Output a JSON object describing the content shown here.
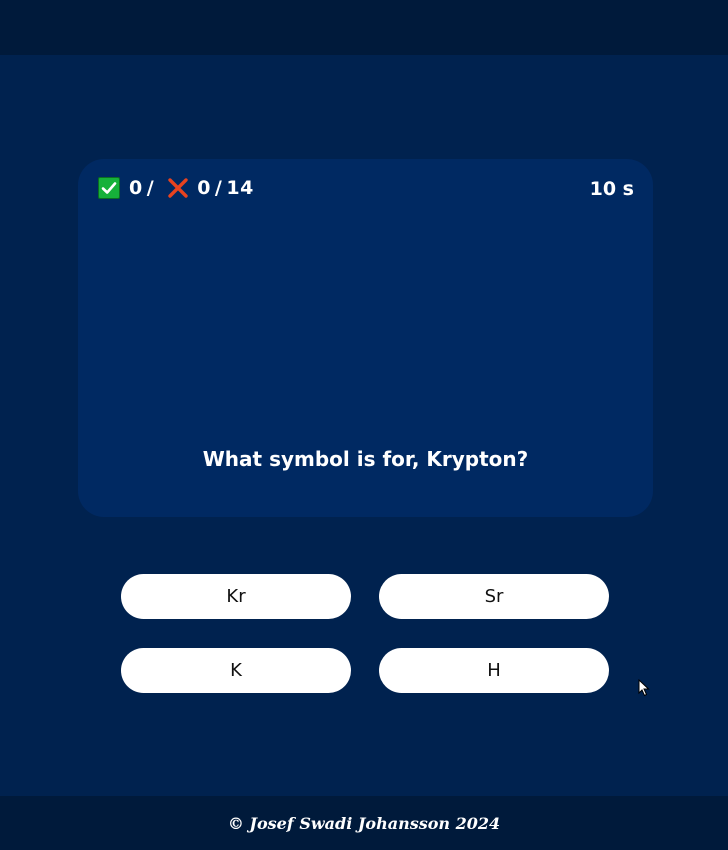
{
  "score": {
    "correct": "0",
    "separator": "/",
    "wrong": "0",
    "total": "14",
    "icons": {
      "correct": "check-icon",
      "wrong": "cross-icon"
    }
  },
  "timer": "10 s",
  "question": "What symbol is for, Krypton?",
  "answers": [
    "Kr",
    "Sr",
    "K",
    "H"
  ],
  "footer": "© Josef Swadi Johansson 2024",
  "colors": {
    "background": "#00224f",
    "bars": "#001a3b",
    "card": "#002962",
    "button": "#ffffff",
    "check": "#16b13a",
    "cross": "#e8431f"
  }
}
